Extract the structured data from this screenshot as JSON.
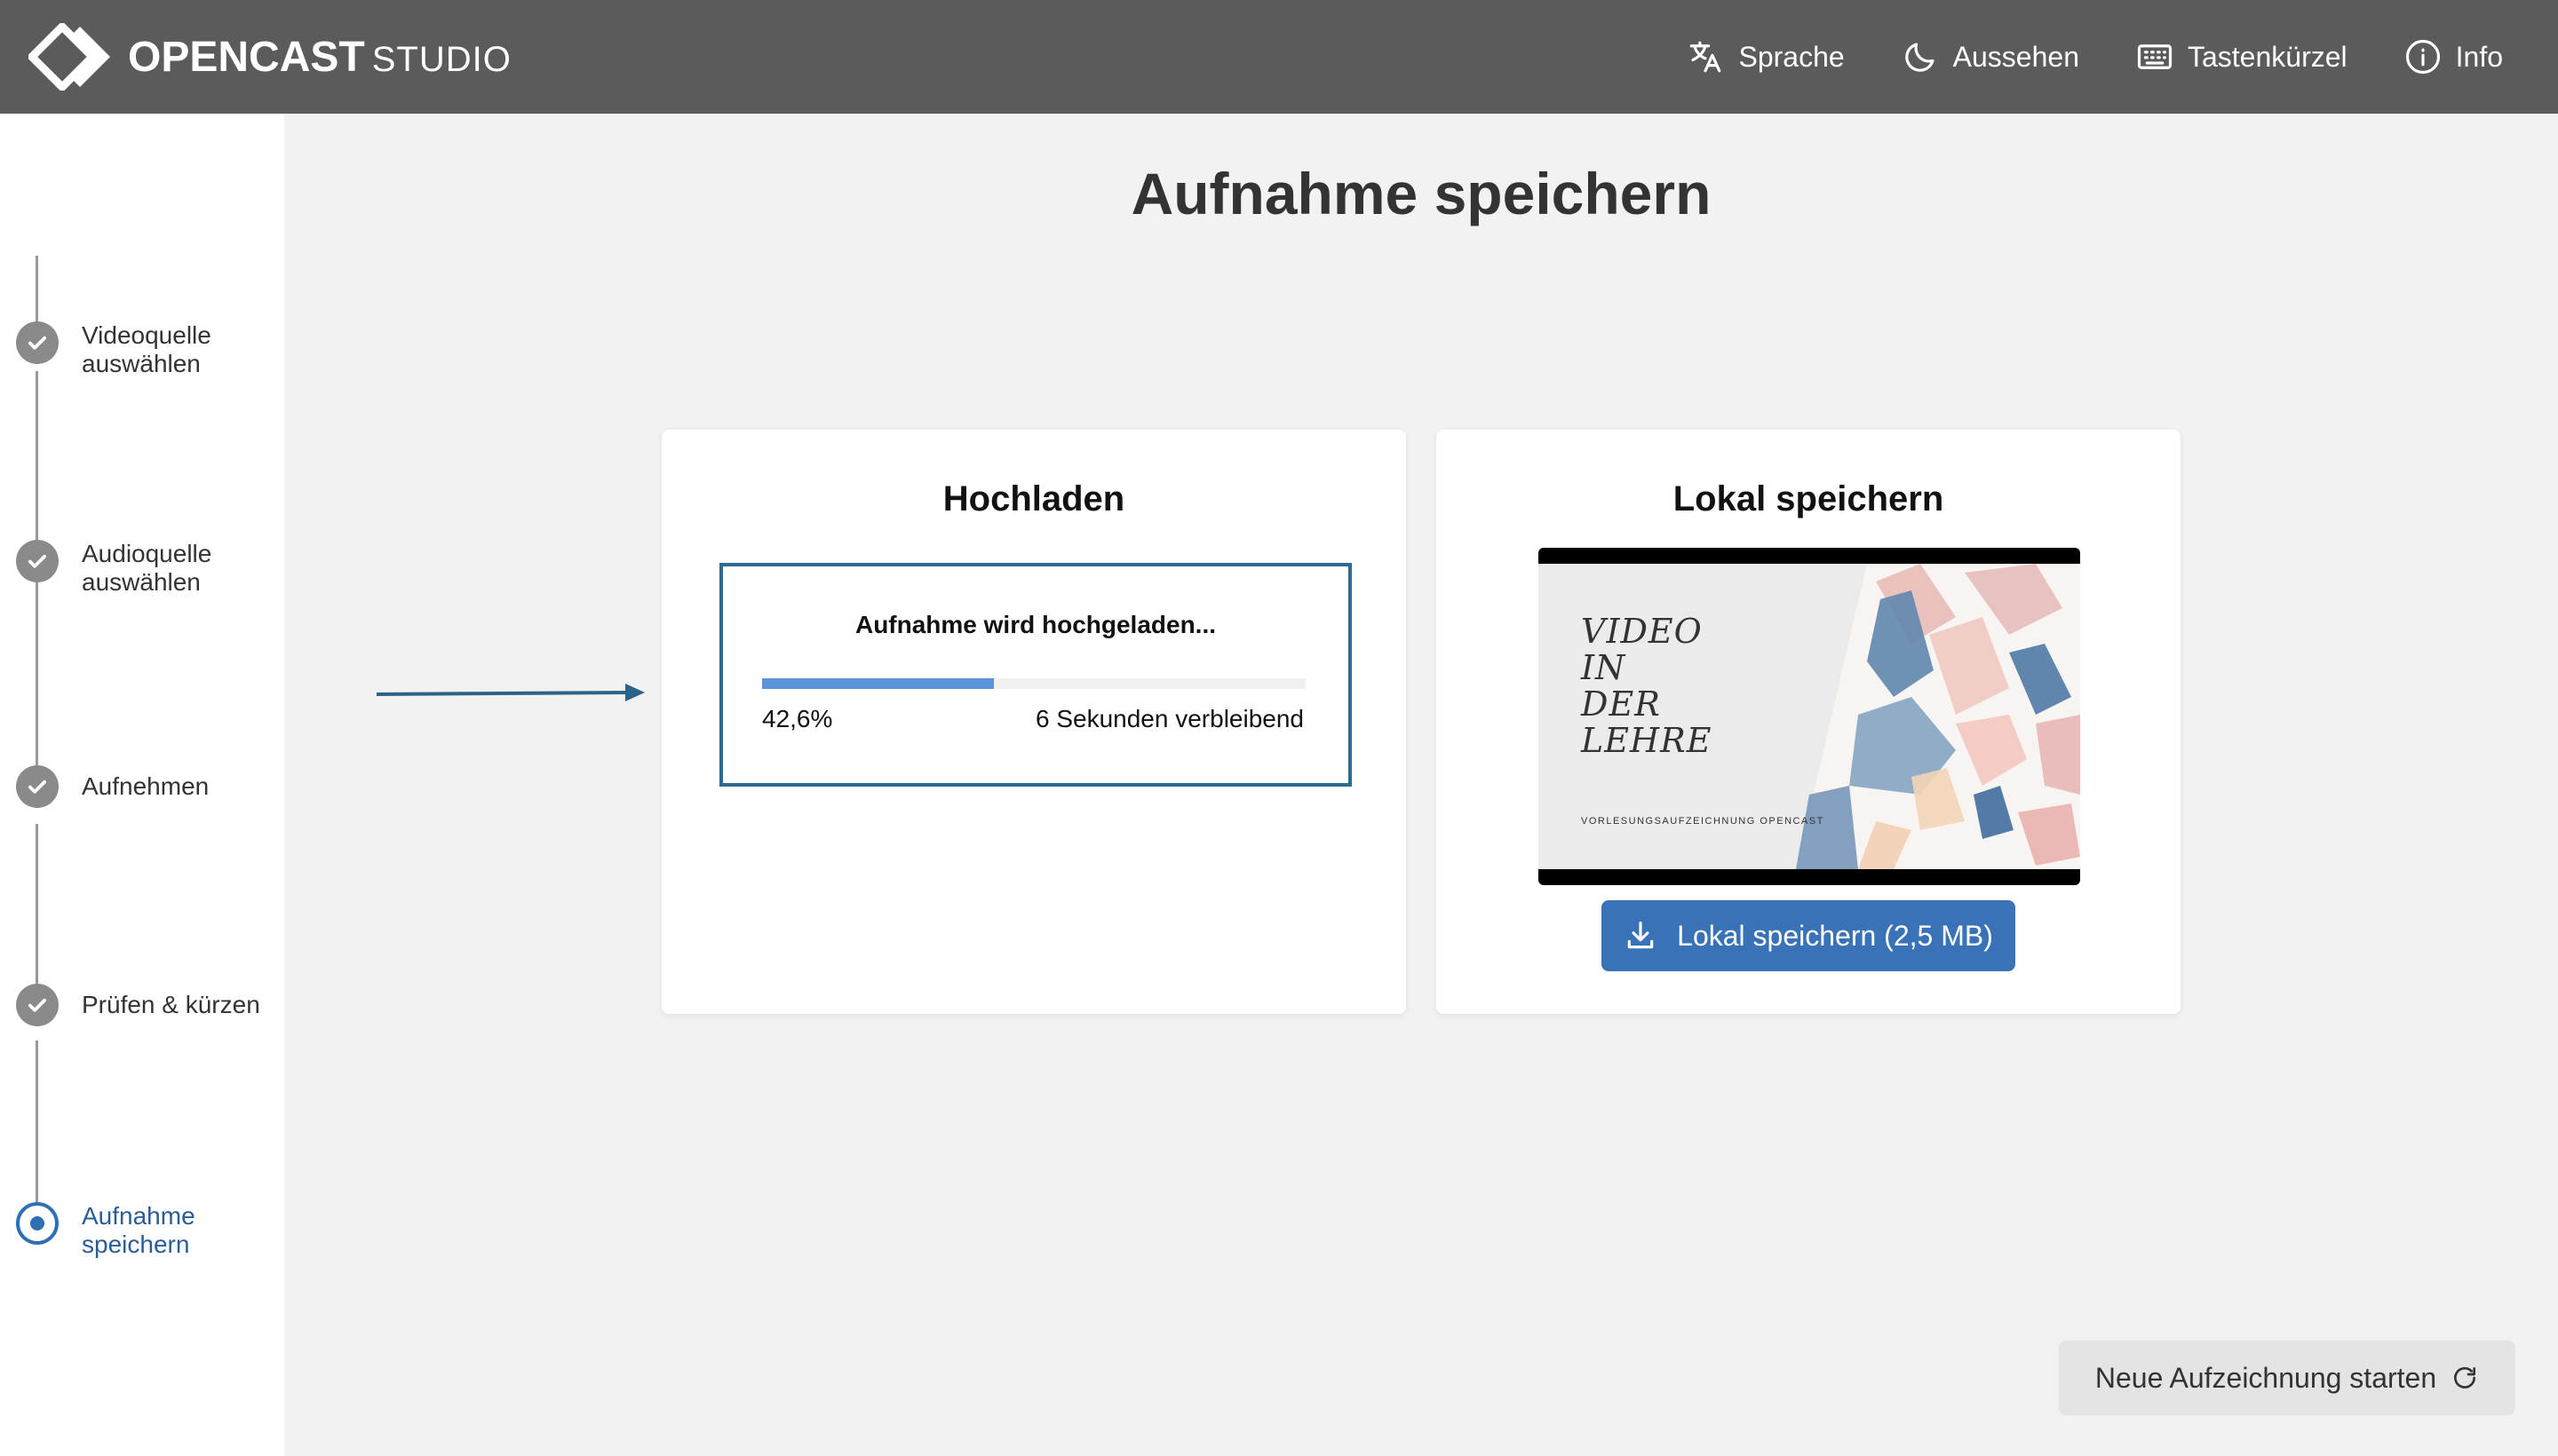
{
  "app": {
    "logo_main": "OPENCAST",
    "logo_sub": "STUDIO"
  },
  "header": {
    "nav": [
      {
        "label": "Sprache",
        "icon": "translate-icon"
      },
      {
        "label": "Aussehen",
        "icon": "moon-icon"
      },
      {
        "label": "Tastenkürzel",
        "icon": "keyboard-icon"
      },
      {
        "label": "Info",
        "icon": "info-icon"
      }
    ]
  },
  "sidebar": {
    "steps": [
      {
        "label": "Videoquelle auswählen",
        "state": "done"
      },
      {
        "label": "Audioquelle auswählen",
        "state": "done"
      },
      {
        "label": "Aufnehmen",
        "state": "done"
      },
      {
        "label": "Prüfen & kürzen",
        "state": "done"
      },
      {
        "label": "Aufnahme speichern",
        "state": "active"
      }
    ]
  },
  "main": {
    "title": "Aufnahme speichern",
    "upload": {
      "title": "Hochladen",
      "status": "Aufnahme wird hochgeladen...",
      "progress_value": 0.426,
      "progress_label": "42,6%",
      "remaining": "6 Sekunden verbleibend"
    },
    "local": {
      "title": "Lokal speichern",
      "video_title_lines": [
        "VIDEO",
        "IN",
        "DER",
        "LEHRE"
      ],
      "video_subtitle": "VORLESUNGSAUFZEICHNUNG OPENCAST",
      "save_button": "Lokal speichern (2,5 MB)"
    },
    "new_recording_button": "Neue Aufzeichnung starten"
  },
  "colors": {
    "header_bg": "#5b5b5b",
    "accent": "#3a72b8",
    "progress": "#5b94d8",
    "upload_border": "#2d6b93",
    "annotation_arrow": "#2c6388"
  }
}
